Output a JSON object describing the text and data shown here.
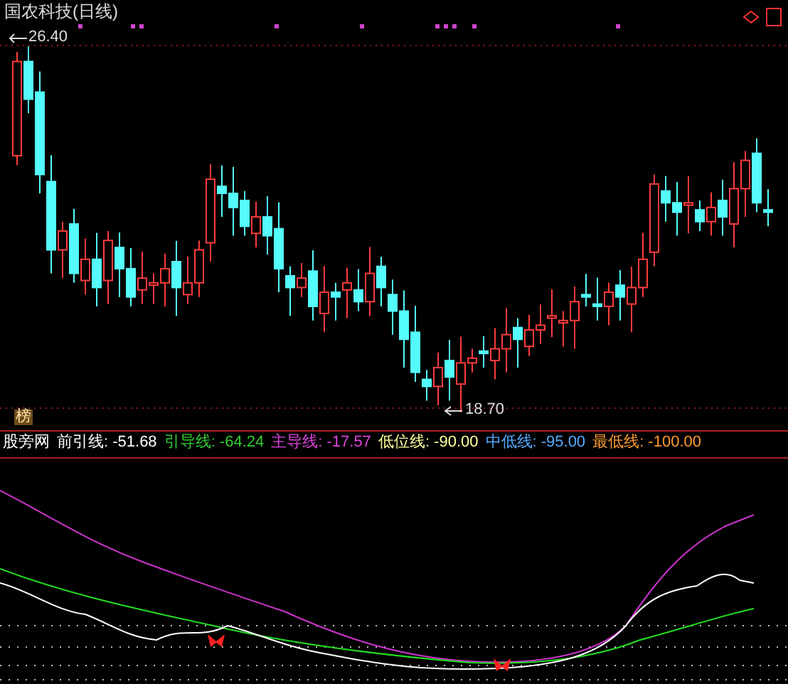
{
  "chart_title": "国农科技(日线)",
  "high_label": "26.40",
  "low_label": "18.70",
  "badge": "榜",
  "indicator": {
    "name": "股旁网",
    "lines": [
      {
        "label": "前引线:",
        "value": "-51.68",
        "color": "#ffffff"
      },
      {
        "label": "引导线:",
        "value": "-64.24",
        "color": "#33cc33"
      },
      {
        "label": "主导线:",
        "value": "-17.57",
        "color": "#dd44dd"
      },
      {
        "label": "低位线:",
        "value": "-90.00",
        "color": "#ffff99"
      },
      {
        "label": "中低线:",
        "value": "-95.00",
        "color": "#55aaff"
      },
      {
        "label": "最低线:",
        "value": "-100.00",
        "color": "#ff9933"
      }
    ]
  }
}
